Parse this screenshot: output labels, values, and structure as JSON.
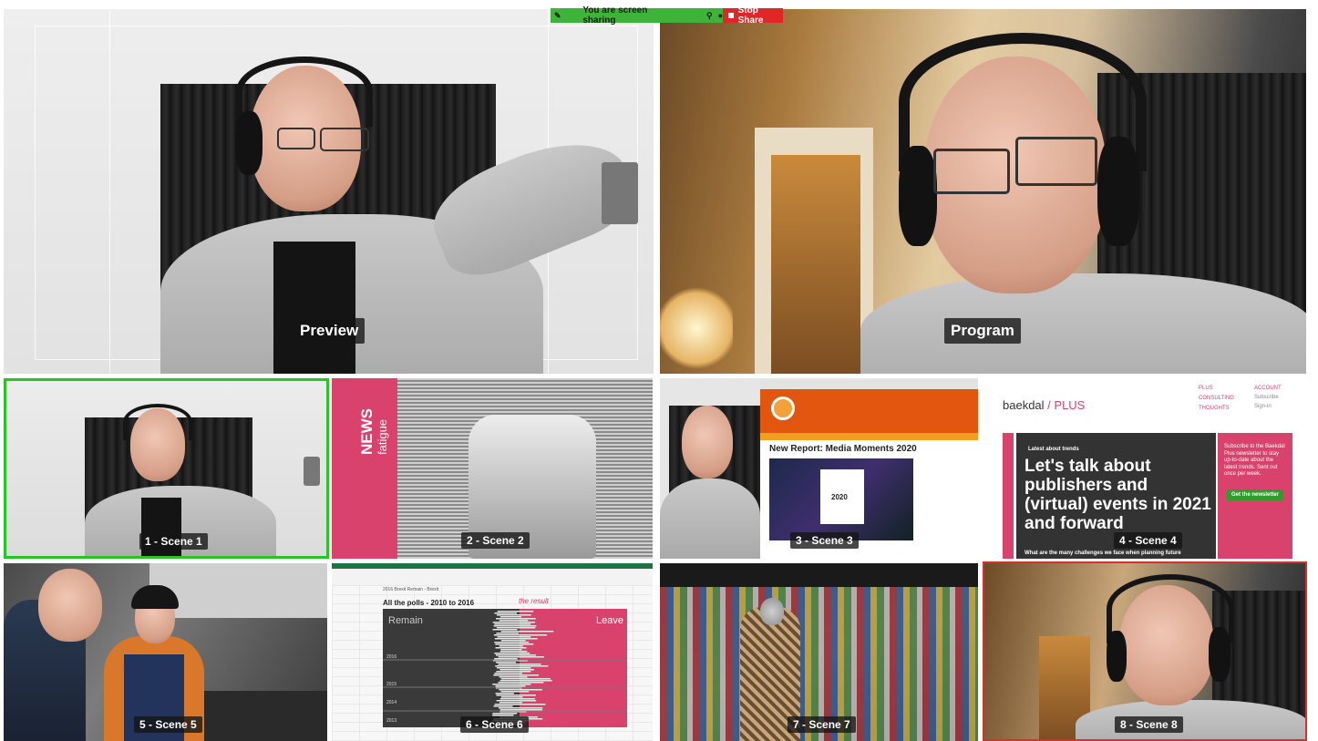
{
  "share_bar": {
    "status_text": "You are screen sharing",
    "stop_label": "Stop Share",
    "colors": {
      "green": "#3fb23a",
      "red": "#e02626"
    }
  },
  "main": {
    "preview_label": "Preview",
    "program_label": "Program"
  },
  "scenes": [
    {
      "label": "1 - Scene 1"
    },
    {
      "label": "2 - Scene 2"
    },
    {
      "label": "3 - Scene 3"
    },
    {
      "label": "4 - Scene 4"
    },
    {
      "label": "5 - Scene 5"
    },
    {
      "label": "6 - Scene 6"
    },
    {
      "label": "7 - Scene 7"
    },
    {
      "label": "8 - Scene 8"
    }
  ],
  "scene2": {
    "title": "NEWS",
    "subtitle": "fatigue"
  },
  "scene3": {
    "page_title": "New Report: Media Moments 2020",
    "image_caption": "2020"
  },
  "scene4": {
    "logo": "baekdal",
    "logo_plus": "/ PLUS",
    "menu": [
      "PLUS",
      "CONSULTING",
      "THOUGHTS"
    ],
    "account": "ACCOUNT",
    "account_links": [
      "Subscribe",
      "Sign-in"
    ],
    "kicker": "Latest about trends",
    "headline": "Let's talk about publishers and (virtual) events in 2021 and forward",
    "bottom_text": "What are the many challenges we face when planning future",
    "side_text": "Subscribe to the Baekdal Plus newsletter to stay up-to-date about the latest trends. Sent out once per week.",
    "button": "Get the newsletter"
  },
  "scene6": {
    "small_title": "2016 Brexit Remain - Brexit",
    "title": "All the polls - 2010 to 2016",
    "remain": "Remain",
    "leave": "Leave",
    "result_note": "the result",
    "years": [
      "2016",
      "2015",
      "2014",
      "2013"
    ]
  },
  "accent": {
    "selected": "#27c627",
    "live": "#d92f2f",
    "pink": "#d9426c"
  }
}
